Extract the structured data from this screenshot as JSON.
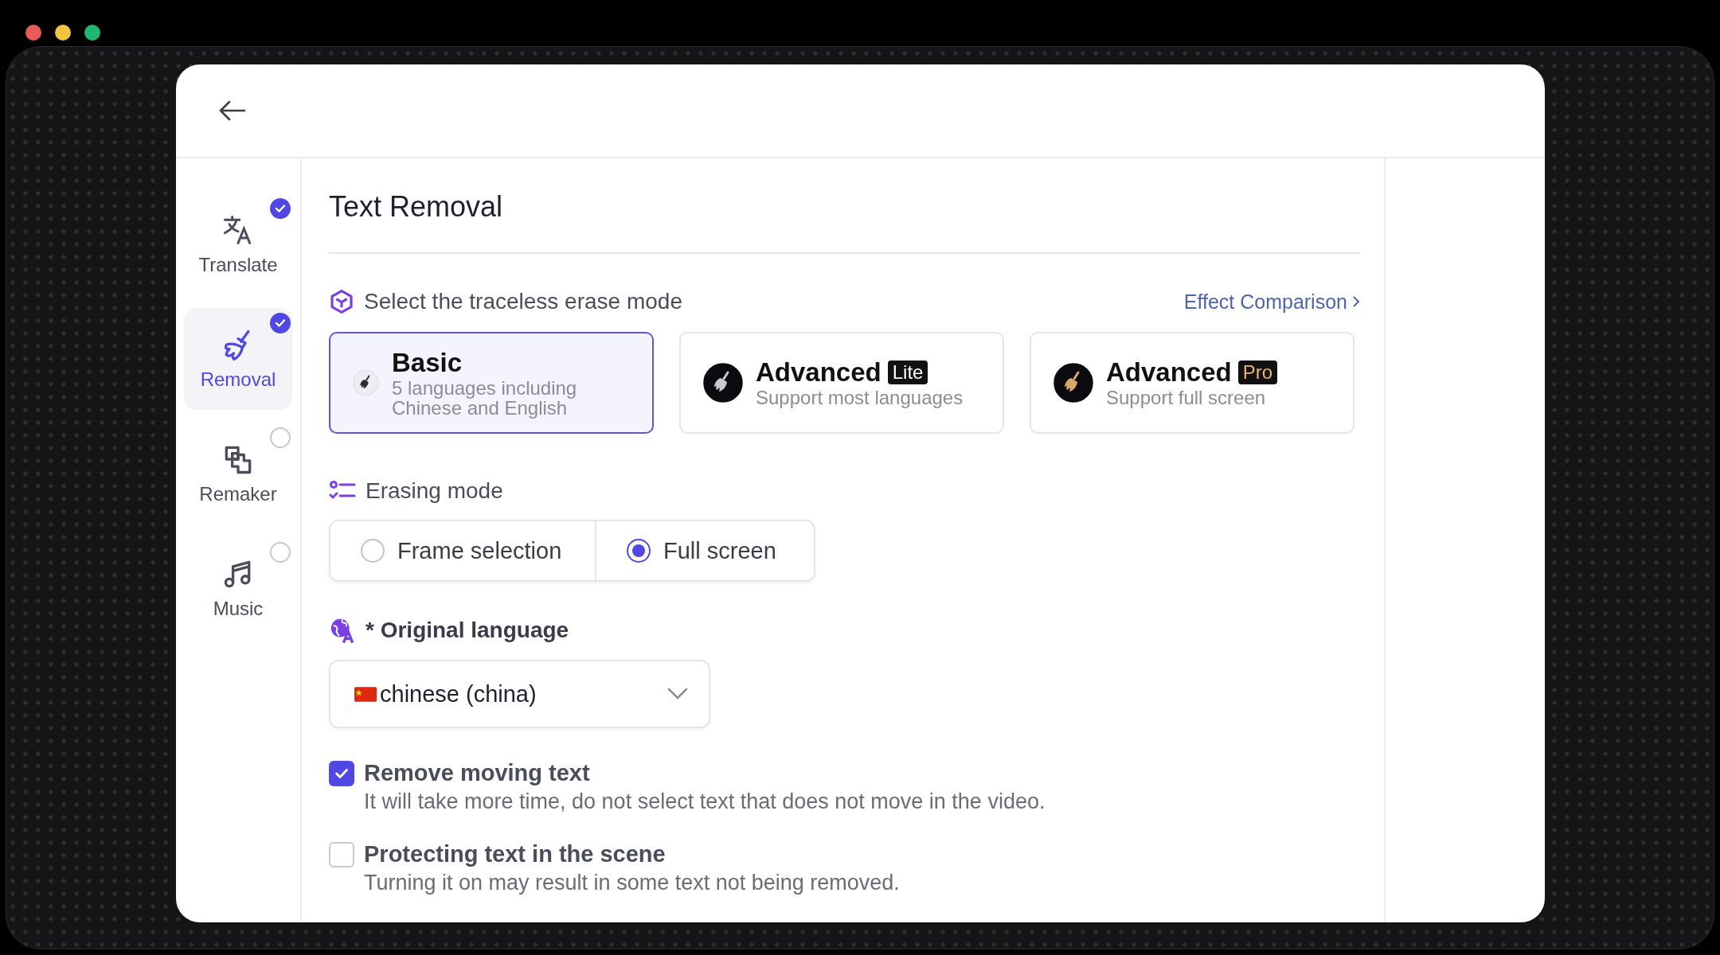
{
  "window": {
    "controls": [
      {
        "color": "#e85a57"
      },
      {
        "color": "#f2c440"
      },
      {
        "color": "#1fb86e"
      }
    ]
  },
  "sidebar": {
    "items": [
      {
        "label": "Translate",
        "kind": "translate",
        "selected": false,
        "done": true
      },
      {
        "label": "Removal",
        "kind": "removal",
        "selected": true,
        "done": true
      },
      {
        "label": "Remaker",
        "kind": "remaker",
        "selected": false,
        "done": false
      },
      {
        "label": "Music",
        "kind": "music",
        "selected": false,
        "done": false
      }
    ]
  },
  "title": "Text Removal",
  "erase_mode": {
    "heading": "Select the traceless erase mode",
    "link": "Effect Comparison",
    "options": [
      {
        "kind": "basic",
        "title": "Basic",
        "subtitle": "5 languages including Chinese and English",
        "selected": true
      },
      {
        "kind": "lite",
        "title": "Advanced",
        "badge": "Lite",
        "subtitle": "Support most languages",
        "selected": false
      },
      {
        "kind": "pro",
        "title": "Advanced",
        "badge": "Pro",
        "subtitle": "Support full screen",
        "selected": false
      }
    ]
  },
  "erasing_mode": {
    "heading": "Erasing mode",
    "options": [
      {
        "label": "Frame selection",
        "selected": false
      },
      {
        "label": "Full screen",
        "selected": true
      }
    ]
  },
  "language": {
    "heading": "* Original language",
    "value": "chinese (china)"
  },
  "options": [
    {
      "label": "Remove moving text",
      "description": "It will take more time, do not select text that does not move in the video.",
      "checked": true
    },
    {
      "label": "Protecting text in the scene",
      "description": "Turning it on may result in some text not being removed.",
      "checked": false
    }
  ]
}
